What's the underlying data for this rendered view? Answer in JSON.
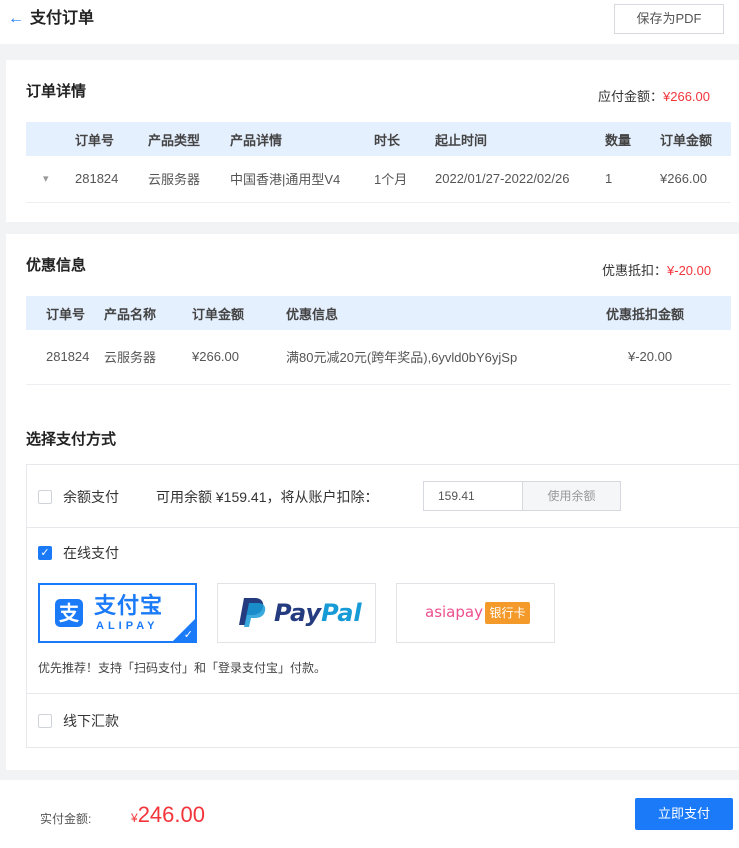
{
  "header": {
    "back_arrow": "←",
    "title": "支付订单",
    "pdf_button": "保存为PDF"
  },
  "order": {
    "title": "订单详情",
    "payable_label": "应付金额：",
    "payable_value": "¥266.00",
    "columns": [
      "订单号",
      "产品类型",
      "产品详情",
      "时长",
      "起止时间",
      "数量",
      "订单金额"
    ],
    "rows": [
      {
        "expand_icon": "▾",
        "cells": [
          "281824",
          "云服务器",
          "中国香港|通用型V4",
          "1个月",
          "2022/01/27-2022/02/26",
          "1",
          "¥266.00"
        ]
      }
    ]
  },
  "discount": {
    "title": "优惠信息",
    "total_label": "优惠抵扣：",
    "total_value": "¥-20.00",
    "columns": [
      "订单号",
      "产品名称",
      "订单金额",
      "优惠信息",
      "优惠抵扣金额"
    ],
    "rows": [
      [
        "281824",
        "云服务器",
        "¥266.00",
        "满80元减20元(跨年奖品),6yvld0bY6yjSp",
        "¥-20.00"
      ]
    ]
  },
  "payment": {
    "title": "选择支付方式",
    "balance_option": {
      "label": "余额支付",
      "checked": false,
      "available_text": "可用余额 ¥159.41，将从账户扣除：",
      "input_value": "159.41",
      "use_button": "使用余额"
    },
    "online_option": {
      "label": "在线支付",
      "checked": true,
      "methods": [
        {
          "name": "alipay",
          "brand_cn": "支付宝",
          "brand_en": "ALIPAY",
          "selected": true
        },
        {
          "name": "paypal",
          "brand_text": "PayPal",
          "selected": false
        },
        {
          "name": "asiapay",
          "brand_text": "asiapay",
          "tag": "银行卡",
          "selected": false
        }
      ],
      "hint": "优先推荐！支持「扫码支付」和「登录支付宝」付款。"
    },
    "offline_option": {
      "label": "线下汇款",
      "checked": false
    }
  },
  "footer": {
    "actual_label": "实付金额:",
    "currency": "¥",
    "amount": "246.00",
    "pay_button": "立即支付"
  },
  "colors": {
    "accent": "#1a7af8",
    "price_red": "#f2353b",
    "alipay_blue": "#1a7af8",
    "paypal_dark": "#253b80",
    "paypal_light": "#179bd7",
    "asiapay_pink": "#ee4f8e",
    "bank_tag_orange": "#f39a2a"
  }
}
